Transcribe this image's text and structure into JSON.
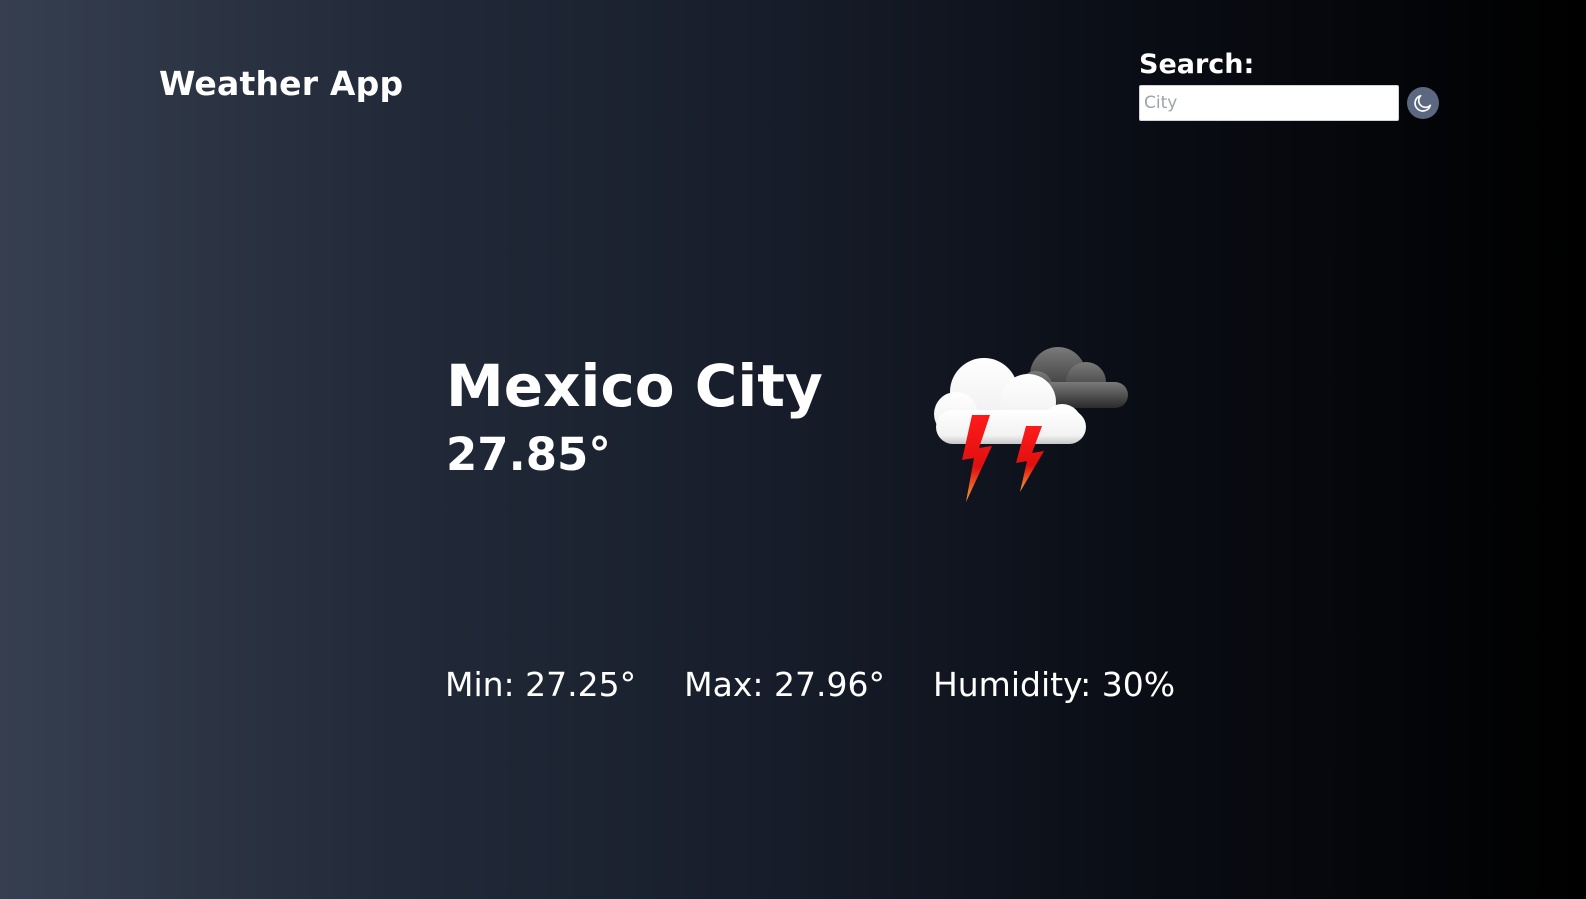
{
  "header": {
    "title": "Weather App"
  },
  "search": {
    "label": "Search:",
    "placeholder": "City",
    "value": "",
    "theme_toggle_icon": "moon-icon"
  },
  "weather": {
    "city": "Mexico City",
    "temperature": "27.85°",
    "condition_icon": "thunderstorm-icon",
    "min": "Min: 27.25°",
    "max": "Max: 27.96°",
    "humidity": "Humidity: 30%"
  },
  "colors": {
    "background_left": "#363f4f",
    "background_right": "#000000",
    "toggle_background": "#5c6880",
    "text": "#ffffff"
  }
}
